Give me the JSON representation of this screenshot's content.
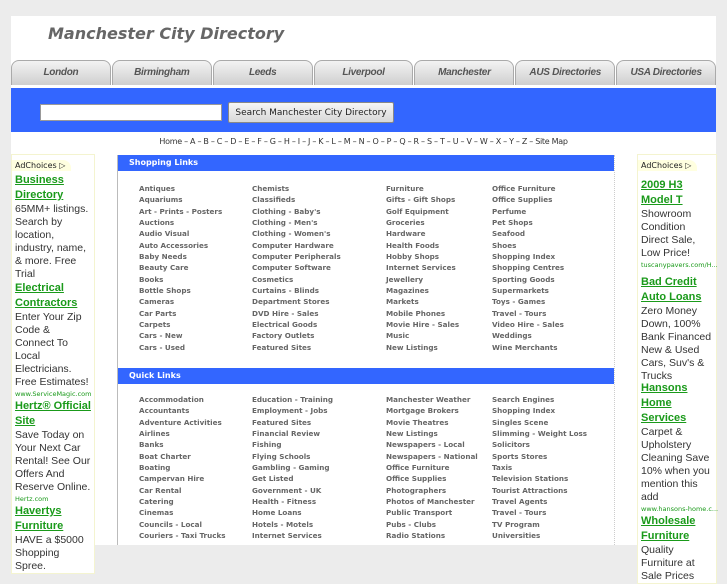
{
  "header": {
    "title": "Manchester City Directory"
  },
  "tabs": [
    "London",
    "Birmingham",
    "Leeds",
    "Liverpool",
    "Manchester",
    "AUS Directories",
    "USA Directories"
  ],
  "search": {
    "placeholder": "",
    "button": "Search Manchester City Directory"
  },
  "alpha_nav": [
    "Home",
    "A",
    "B",
    "C",
    "D",
    "E",
    "F",
    "G",
    "H",
    "I",
    "J",
    "K",
    "L",
    "M",
    "N",
    "O",
    "P",
    "Q",
    "R",
    "S",
    "T",
    "U",
    "V",
    "W",
    "X",
    "Y",
    "Z",
    "Site Map"
  ],
  "colors": {
    "accent": "#3366ff",
    "ad_title": "#1a9a1a"
  },
  "sections": [
    {
      "title": "Shopping Links",
      "columns": [
        [
          "Antiques",
          "Aquariums",
          "Art - Prints - Posters",
          "Auctions",
          "Audio Visual",
          "Auto Accessories",
          "Baby Needs",
          "Beauty Care",
          "Books",
          "Bottle Shops",
          "Cameras",
          "Car Parts",
          "Carpets",
          "Cars - New",
          "Cars - Used"
        ],
        [
          "Chemists",
          "Classifieds",
          "Clothing - Baby's",
          "Clothing - Men's",
          "Clothing - Women's",
          "Computer Hardware",
          "Computer Peripherals",
          "Computer Software",
          "Cosmetics",
          "Curtains - Blinds",
          "Department Stores",
          "DVD Hire - Sales",
          "Electrical Goods",
          "Factory Outlets",
          "Featured Sites"
        ],
        [
          "Furniture",
          "Gifts - Gift Shops",
          "Golf Equipment",
          "Groceries",
          "Hardware",
          "Health Foods",
          "Hobby Shops",
          "Internet Services",
          "Jewellery",
          "Magazines",
          "Markets",
          "Mobile Phones",
          "Movie Hire - Sales",
          "Music",
          "New Listings"
        ],
        [
          "Office Furniture",
          "Office Supplies",
          "Perfume",
          "Pet Shops",
          "Seafood",
          "Shoes",
          "Shopping Index",
          "Shopping Centres",
          "Sporting Goods",
          "Supermarkets",
          "Toys - Games",
          "Travel - Tours",
          "Video Hire - Sales",
          "Weddings",
          "Wine Merchants"
        ]
      ]
    },
    {
      "title": "Quick Links",
      "columns": [
        [
          "Accommodation",
          "Accountants",
          "Adventure Activities",
          "Airlines",
          "Banks",
          "Boat Charter",
          "Boating",
          "Campervan Hire",
          "Car Rental",
          "Catering",
          "Cinemas",
          "Councils - Local",
          "Couriers - Taxi Trucks"
        ],
        [
          "Education - Training",
          "Employment - Jobs",
          "Featured Sites",
          "Financial Review",
          "Fishing",
          "Flying Schools",
          "Gambling - Gaming",
          "Get Listed",
          "Government - UK",
          "Health - Fitness",
          "Home Loans",
          "Hotels - Motels",
          "Internet Services"
        ],
        [
          "Manchester Weather",
          "Mortgage Brokers",
          "Movie Theatres",
          "New Listings",
          "Newspapers - Local",
          "Newspapers - National",
          "Office Furniture",
          "Office Supplies",
          "Photographers",
          "Photos of Manchester",
          "Public Transport",
          "Pubs - Clubs",
          "Radio Stations"
        ],
        [
          "Search Engines",
          "Shopping Index",
          "Singles Scene",
          "Slimming - Weight Loss",
          "Solicitors",
          "Sports Stores",
          "Taxis",
          "Television Stations",
          "Tourist Attractions",
          "Travel Agents",
          "Travel - Tours",
          "TV Program",
          "Universities"
        ]
      ]
    }
  ],
  "ads_left": {
    "label": "AdChoices",
    "items": [
      {
        "title": "Business Directory",
        "desc": "65MM+ listings. Search by location, industry, name, & more. Free Trial",
        "url": ""
      },
      {
        "title": "Electrical Contractors",
        "desc": "Enter Your Zip Code & Connect To Local Electricians. Free Estimates!",
        "url": "www.ServiceMagic.com"
      },
      {
        "title": "Hertz® Official Site",
        "desc": "Save Today on Your Next Car Rental! See Our Offers And Reserve Online.",
        "url": "Hertz.com"
      },
      {
        "title": "Havertys Furniture",
        "desc": "HAVE a $5000 Shopping Spree.",
        "url": ""
      }
    ]
  },
  "ads_right": {
    "label": "AdChoices",
    "items": [
      {
        "title": "2009 H3 Model T",
        "desc": "Showroom Condition Direct Sale, Low Price!",
        "url": "tuscanypavers.com/H..."
      },
      {
        "title": "Bad Credit Auto Loans",
        "desc": "Zero Money Down, 100% Bank Financed New & Used Cars, Suv's & Trucks",
        "url": ""
      },
      {
        "title": "Hansons Home Services",
        "desc": "Carpet & Upholstery Cleaning Save 10% when you mention this add",
        "url": "www.hansons-home.c..."
      },
      {
        "title": "Wholesale Furniture",
        "desc": "Quality Furniture at Sale Prices",
        "url": ""
      }
    ]
  }
}
